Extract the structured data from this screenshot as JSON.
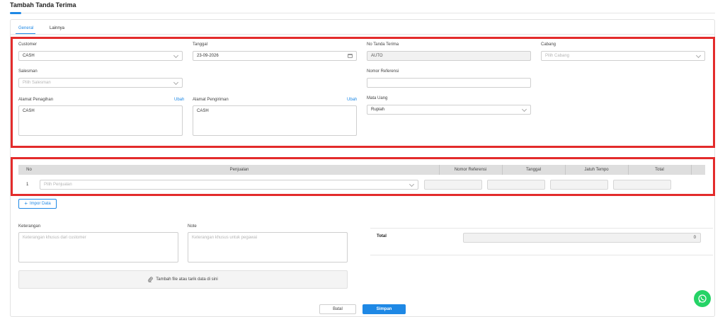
{
  "page": {
    "title": "Tambah Tanda Terima"
  },
  "tabs": [
    {
      "label": "General",
      "active": true
    },
    {
      "label": "Lainnya",
      "active": false
    }
  ],
  "form": {
    "customer": {
      "label": "Customer",
      "value": "CASH"
    },
    "tanggal": {
      "label": "Tanggal",
      "value": "23-09-2026"
    },
    "no_tanda_terima": {
      "label": "No Tanda Terima",
      "value": "AUTO"
    },
    "cabang": {
      "label": "Cabang",
      "placeholder": "Pilih Cabang"
    },
    "salesman": {
      "label": "Salesman",
      "placeholder": "Pilih Salesman"
    },
    "nomor_referensi": {
      "label": "Nomor Referensi",
      "value": ""
    },
    "alamat_penagihan": {
      "label": "Alamat Penagihan",
      "link": "Ubah",
      "value": "CASH"
    },
    "alamat_pengiriman": {
      "label": "Alamat Pengiriman",
      "link": "Ubah",
      "value": "CASH"
    },
    "mata_uang": {
      "label": "Mata Uang",
      "value": "Rupiah"
    }
  },
  "table": {
    "headers": [
      "No",
      "Penjualan",
      "Nomor Referensi",
      "Tanggal",
      "Jatuh Tempo",
      "Total"
    ],
    "rows": [
      {
        "no": "1",
        "penjualan_placeholder": "Pilih Penjualan"
      }
    ]
  },
  "import_button": {
    "label": "Impor Data"
  },
  "keterangan": {
    "label": "Keterangan",
    "placeholder": "Keterangan khusus dari customer"
  },
  "note": {
    "label": "Note",
    "placeholder": "Keterangan khusus untuk pegawai"
  },
  "summary": {
    "total_label": "Total",
    "total_value": "0"
  },
  "upload": {
    "label": "Tambah file atau tarik data di sini"
  },
  "actions": {
    "cancel_label": "Batal",
    "save_label": "Simpan"
  },
  "icons": {
    "chat": "whatsapp-icon",
    "upload": "paperclip-icon",
    "add": "plus-icon",
    "date": "calendar-icon"
  },
  "colors": {
    "accent": "#1e88e5",
    "highlight": "#e32b2b",
    "chat": "#25d366"
  }
}
